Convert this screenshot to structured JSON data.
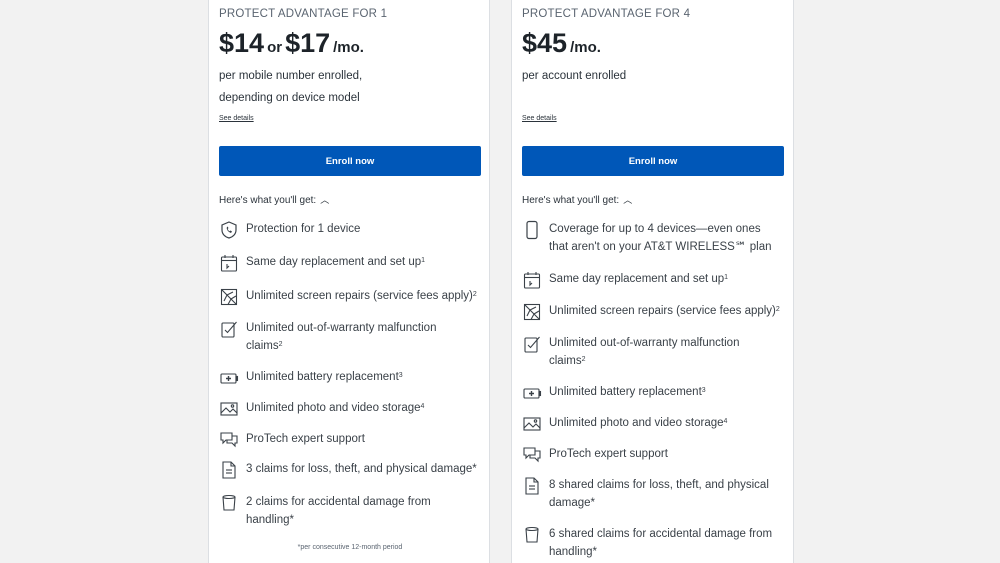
{
  "colors": {
    "accent": "#0057b8",
    "page_bg": "#f2f2f2",
    "card_bg": "#ffffff",
    "text": "#1d2329"
  },
  "plans": [
    {
      "title": "PROTECT ADVANTAGE FOR 1",
      "price_main": "$14",
      "price_or": "or",
      "price_alt": "$17",
      "price_unit": "/mo.",
      "subtext_1": "per mobile number enrolled,",
      "subtext_2": "depending on device model",
      "see_details": "See details",
      "enroll_label": "Enroll now",
      "whats_included_label": "Here's what you'll get:",
      "features": [
        {
          "icon": "shield-phone-icon",
          "line1": "Protection for 1 device",
          "line2": "",
          "sup": ""
        },
        {
          "icon": "calendar-icon",
          "line1": "Same day replacement and set up",
          "line2": "",
          "sup": "1"
        },
        {
          "icon": "cracked-screen-icon",
          "line1": "Unlimited screen repairs (service fees apply)",
          "line2": "",
          "sup": "2"
        },
        {
          "icon": "repair-checklist-icon",
          "line1": "Unlimited out-of-warranty malfunction",
          "line2": "claims",
          "sup": "2"
        },
        {
          "icon": "battery-icon",
          "line1": "Unlimited battery replacement",
          "line2": "",
          "sup": "3"
        },
        {
          "icon": "photo-icon",
          "line1": "Unlimited photo and video storage",
          "line2": "",
          "sup": "4"
        },
        {
          "icon": "chat-bubbles-icon",
          "line1": "ProTech expert support",
          "line2": "",
          "sup": ""
        },
        {
          "icon": "document-icon",
          "line1": "3 claims for loss, theft, and physical damage*",
          "line2": "",
          "sup": ""
        },
        {
          "icon": "cup-icon",
          "line1": "2 claims for accidental damage from",
          "line2": "handling*",
          "sup": ""
        }
      ],
      "footnote": "*per consecutive 12-month period"
    },
    {
      "title": "PROTECT ADVANTAGE FOR 4",
      "price_main": "$45",
      "price_unit": "/mo.",
      "subtext_1": "per account enrolled",
      "see_details": "See details",
      "enroll_label": "Enroll now",
      "whats_included_label": "Here's what you'll get:",
      "features": [
        {
          "icon": "phone-icon",
          "line1": "Coverage for up to 4 devices—even ones",
          "line2": "that aren't on your AT&T WIRELESS℠ plan",
          "sup": ""
        },
        {
          "icon": "calendar-icon",
          "line1": "Same day replacement and set up",
          "line2": "",
          "sup": "1"
        },
        {
          "icon": "cracked-screen-icon",
          "line1": "Unlimited screen repairs (service fees apply)",
          "line2": "",
          "sup": "2"
        },
        {
          "icon": "repair-checklist-icon",
          "line1": "Unlimited out-of-warranty malfunction",
          "line2": "claims",
          "sup": "2"
        },
        {
          "icon": "battery-icon",
          "line1": "Unlimited battery replacement",
          "line2": "",
          "sup": "3"
        },
        {
          "icon": "photo-icon",
          "line1": "Unlimited photo and video storage",
          "line2": "",
          "sup": "4"
        },
        {
          "icon": "chat-bubbles-icon",
          "line1": "ProTech expert support",
          "line2": "",
          "sup": ""
        },
        {
          "icon": "document-icon",
          "line1": "8 shared claims for loss, theft, and physical",
          "line2": "damage*",
          "sup": ""
        },
        {
          "icon": "cup-icon",
          "line1": "6 shared claims for accidental damage from",
          "line2": "handling*",
          "sup": ""
        }
      ]
    }
  ]
}
